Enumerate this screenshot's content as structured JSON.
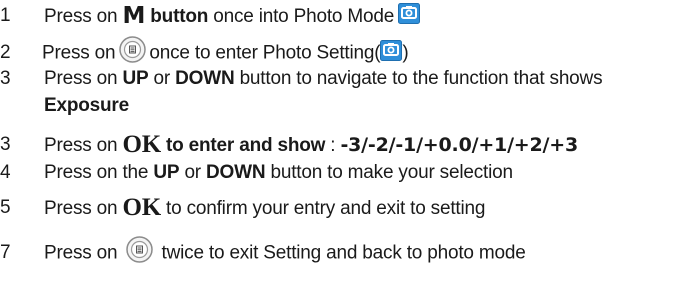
{
  "steps": [
    {
      "number": "1",
      "pre": "Press on ",
      "key": "M",
      "key_suffix": " button",
      "post": " once into Photo Mode",
      "icon": "camera-mode-icon"
    },
    {
      "number": "2",
      "pre": "Press on",
      "icon": "menu-button-icon",
      "post": "once to enter Photo Setting(",
      "icon2": "camera-mode-icon",
      "post2": ")"
    },
    {
      "number": "3",
      "pre": "Press on ",
      "b1": "UP",
      "mid": " or ",
      "b2": "DOWN",
      "post": " button to navigate to the function that shows",
      "line2": "Exposure"
    },
    {
      "number": "3",
      "pre": "Press on ",
      "key": "OK",
      "bold_part": " to enter and show",
      "sep": " : ",
      "values": "-3/-2/-1/+0.0/+1/+2/+3"
    },
    {
      "number": "4",
      "pre": "Press on the ",
      "b1": "UP",
      "mid": " or ",
      "b2": "DOWN",
      "post": " button to make your selection"
    },
    {
      "number": "5",
      "pre": "Press on ",
      "key": "OK",
      "post": " to confirm your entry and exit to setting"
    },
    {
      "number": "7",
      "pre": "Press on ",
      "icon": "menu-button-icon",
      "post": " twice to exit Setting and back to photo mode"
    }
  ],
  "colors": {
    "text": "#1a1a1a",
    "camera_icon_blue": "#2f8fd9",
    "menu_icon_gray": "#8c8c8c"
  }
}
